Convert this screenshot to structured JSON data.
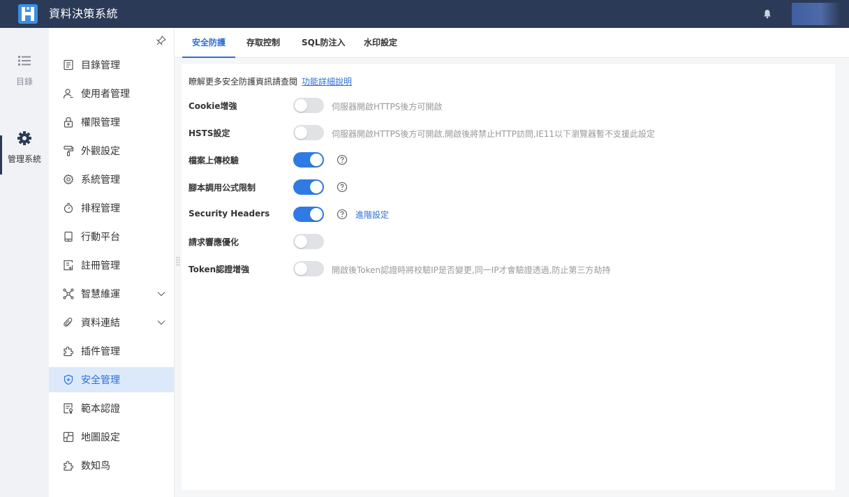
{
  "header": {
    "app_title": "資料決策系統"
  },
  "rail": {
    "items": [
      {
        "label": "目錄",
        "icon": "list-icon"
      },
      {
        "label": "管理系統",
        "icon": "gear-icon",
        "active": true
      }
    ]
  },
  "menu": {
    "items": [
      {
        "label": "目錄管理",
        "icon": "catalog-icon"
      },
      {
        "label": "使用者管理",
        "icon": "user-icon"
      },
      {
        "label": "權限管理",
        "icon": "lock-icon"
      },
      {
        "label": "外觀設定",
        "icon": "paint-roller-icon"
      },
      {
        "label": "系統管理",
        "icon": "gear-icon"
      },
      {
        "label": "排程管理",
        "icon": "stopwatch-icon"
      },
      {
        "label": "行動平台",
        "icon": "mobile-icon"
      },
      {
        "label": "註冊管理",
        "icon": "register-icon"
      },
      {
        "label": "智慧維運",
        "icon": "network-icon",
        "expandable": true
      },
      {
        "label": "資料連結",
        "icon": "paperclip-icon",
        "expandable": true
      },
      {
        "label": "插件管理",
        "icon": "puzzle-icon"
      },
      {
        "label": "安全管理",
        "icon": "shield-icon",
        "active": true
      },
      {
        "label": "範本認證",
        "icon": "certificate-icon"
      },
      {
        "label": "地圖設定",
        "icon": "map-icon"
      },
      {
        "label": "数知鸟",
        "icon": "puzzle-icon"
      }
    ]
  },
  "tabs": [
    {
      "label": "安全防護",
      "active": true
    },
    {
      "label": "存取控制"
    },
    {
      "label": "SQL防注入"
    },
    {
      "label": "水印設定"
    }
  ],
  "content": {
    "intro_text": "瞭解更多安全防護資訊請查閱",
    "intro_link": "功能詳細說明",
    "settings": [
      {
        "label": "Cookie增強",
        "on": false,
        "desc": "伺服器開啟HTTPS後方可開啟"
      },
      {
        "label": "HSTS設定",
        "on": false,
        "desc": "伺服器開啟HTTPS後方可開啟,開啟後將禁止HTTP訪問,IE11以下瀏覽器暫不支援此設定"
      },
      {
        "label": "檔案上傳校驗",
        "on": true,
        "help": true
      },
      {
        "label": "腳本調用公式限制",
        "on": true,
        "help": true
      },
      {
        "label": "Security Headers",
        "on": true,
        "help": true,
        "link": "進階設定"
      },
      {
        "label": "請求響應優化",
        "on": false
      },
      {
        "label": "Token認證增強",
        "on": false,
        "desc": "開啟後Token認證時將校驗IP是否變更,同一IP才會驗證透過,防止第三方劫持"
      }
    ]
  },
  "colors": {
    "header_bg": "#2b3a57",
    "accent": "#2f7ae5",
    "active_menu_bg": "#dce9fb"
  }
}
